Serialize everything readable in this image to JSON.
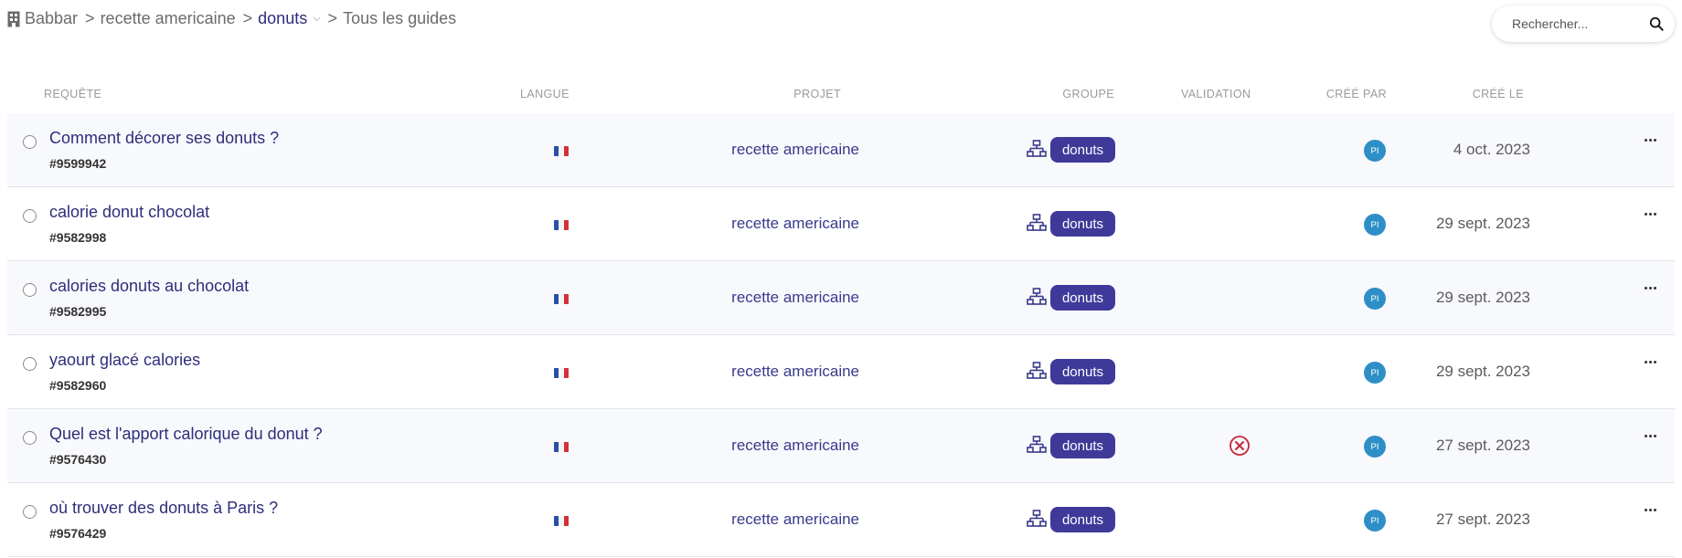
{
  "breadcrumb": {
    "items": [
      {
        "label": "Babbar"
      },
      {
        "label": "recette americaine"
      },
      {
        "label": "donuts"
      },
      {
        "label": "Tous les guides"
      }
    ],
    "separator": ">",
    "caret": "⌵"
  },
  "search": {
    "placeholder": "Rechercher..."
  },
  "columns": {
    "requete": "REQUÊTE",
    "langue": "LANGUE",
    "projet": "PROJET",
    "groupe": "GROUPE",
    "validation": "VALIDATION",
    "cree_par": "CRÉÉ PAR",
    "cree_le": "CRÉÉ LE"
  },
  "colors": {
    "accent": "#3f3a9a",
    "title_text": "#2e2e7a",
    "avatar": "#2e8fc6",
    "error": "#c4283a",
    "flag_blue": "#2a4fa8",
    "flag_white": "#f4f4f4",
    "flag_red": "#d3303c"
  },
  "rows": [
    {
      "title": "Comment décorer ses donuts ?",
      "id": "#9599942",
      "project": "recette americaine",
      "group": "donuts",
      "validation": "",
      "creator": "PI",
      "date": "4 oct. 2023"
    },
    {
      "title": "calorie donut chocolat",
      "id": "#9582998",
      "project": "recette americaine",
      "group": "donuts",
      "validation": "",
      "creator": "PI",
      "date": "29 sept. 2023"
    },
    {
      "title": "calories donuts au chocolat",
      "id": "#9582995",
      "project": "recette americaine",
      "group": "donuts",
      "validation": "",
      "creator": "PI",
      "date": "29 sept. 2023"
    },
    {
      "title": "yaourt glacé calories",
      "id": "#9582960",
      "project": "recette americaine",
      "group": "donuts",
      "validation": "",
      "creator": "PI",
      "date": "29 sept. 2023"
    },
    {
      "title": "Quel est l'apport calorique du donut ?",
      "id": "#9576430",
      "project": "recette americaine",
      "group": "donuts",
      "validation": "rejected",
      "creator": "PI",
      "date": "27 sept. 2023"
    },
    {
      "title": "où trouver des donuts à Paris ?",
      "id": "#9576429",
      "project": "recette americaine",
      "group": "donuts",
      "validation": "",
      "creator": "PI",
      "date": "27 sept. 2023"
    }
  ]
}
